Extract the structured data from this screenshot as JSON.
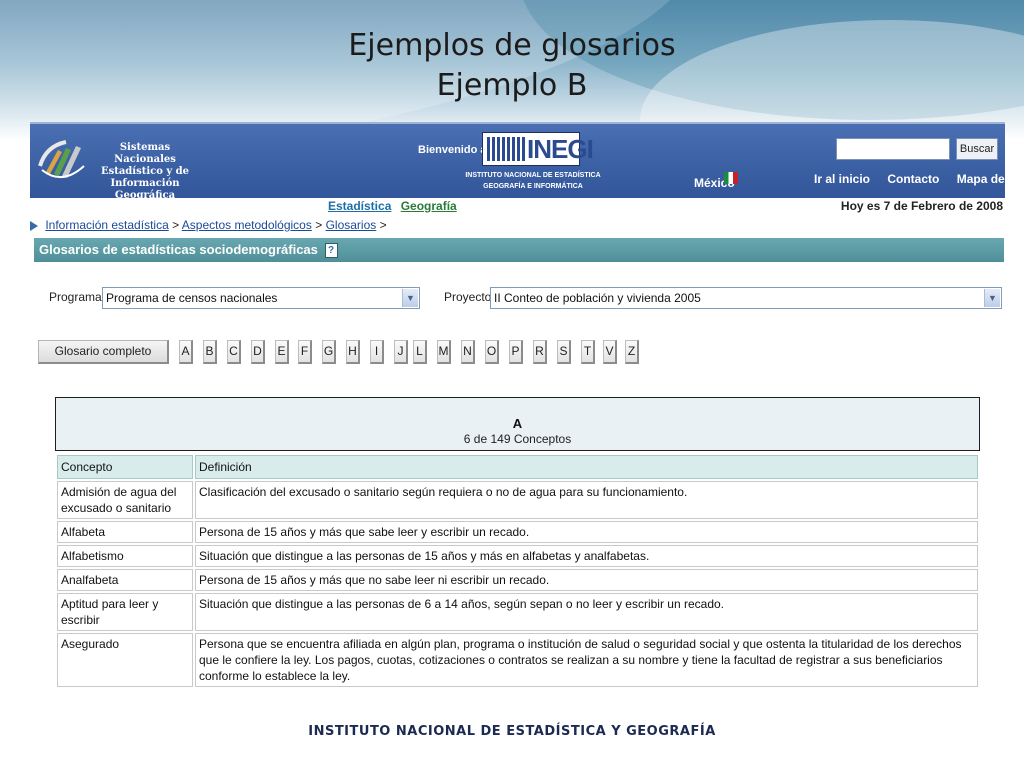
{
  "slide": {
    "title_line1": "Ejemplos de glosarios",
    "title_line2": "Ejemplo B",
    "footer": "INSTITUTO NACIONAL  DE ESTADÍSTICA Y GEOGRAFÍA"
  },
  "header": {
    "logo_text": "Sistemas Nacionales Estadístico y de Información Geográfica",
    "welcome": "Bienvenido al",
    "inegi": "INEGI",
    "inegi_sub": "INSTITUTO NACIONAL DE ESTADÍSTICA GEOGRAFÍA E INFORMÁTICA",
    "mexico": "México",
    "search_button": "Buscar",
    "links": [
      "Ir al inicio",
      "Contacto",
      "Mapa de sitio"
    ]
  },
  "subnav": {
    "tabs": [
      "Estadística",
      "Geografía"
    ],
    "date": "Hoy es 7 de Febrero de 2008"
  },
  "breadcrumb": {
    "items": [
      "Información estadística",
      "Aspectos metodológicos",
      "Glosarios"
    ],
    "separator": ">"
  },
  "section": {
    "title": "Glosarios de estadísticas sociodemográficas",
    "help": "?"
  },
  "filters": {
    "programa_label": "Programa:",
    "programa_value": "Programa de censos nacionales",
    "proyecto_label": "Proyecto:",
    "proyecto_value": "II Conteo de población y vivienda 2005"
  },
  "letters": {
    "full_button": "Glosario completo",
    "items": [
      "A",
      "B",
      "C",
      "D",
      "E",
      "F",
      "G",
      "H",
      "I",
      "J",
      "L",
      "M",
      "N",
      "O",
      "P",
      "R",
      "S",
      "T",
      "V",
      "Z"
    ]
  },
  "results": {
    "letter": "A",
    "count": "6 de 149 Conceptos",
    "columns": [
      "Concepto",
      "Definición"
    ],
    "rows": [
      [
        "Admisión de agua del excusado o sanitario",
        "Clasificación del excusado o sanitario según requiera o no de agua para su funcionamiento."
      ],
      [
        "Alfabeta",
        "Persona de 15 años y más que sabe leer y escribir un recado."
      ],
      [
        "Alfabetismo",
        "Situación que distingue a las personas de 15 años y más en alfabetas y analfabetas."
      ],
      [
        "Analfabeta",
        "Persona de 15 años y más que no sabe leer ni escribir un recado."
      ],
      [
        "Aptitud para leer y escribir",
        "Situación que distingue a las personas de 6 a 14 años, según sepan o no leer y escribir un recado."
      ],
      [
        "Asegurado",
        "Persona que se encuentra afiliada en algún plan, programa o institución de salud o seguridad social y que ostenta la titularidad de los derechos que le confiere la ley. Los pagos, cuotas, cotizaciones o contratos se realizan a su nombre y tiene la facultad de registrar a sus beneficiarios conforme lo establece la ley."
      ]
    ]
  },
  "colors": {
    "header_blue": "#3b5fa3",
    "section_teal": "#4f8f99",
    "table_header": "#d9ecec"
  }
}
